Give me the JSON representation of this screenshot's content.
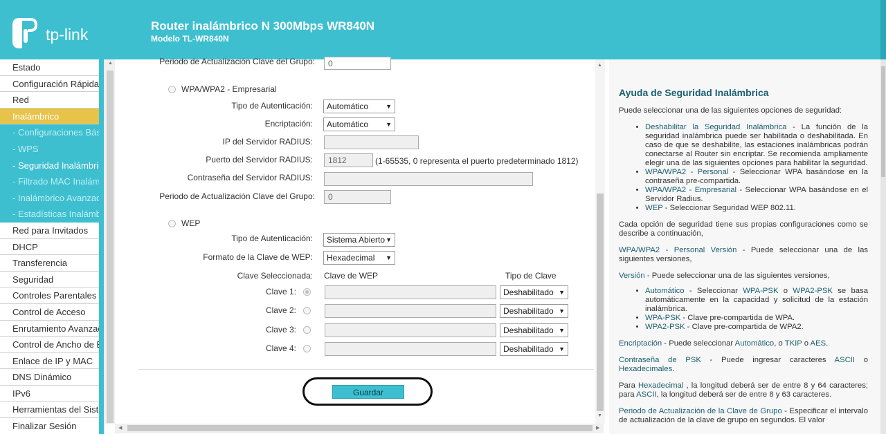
{
  "header": {
    "logo_text": "tp-link",
    "title": "Router inalámbrico N 300Mbps WR840N",
    "model": "Modelo TL-WR840N"
  },
  "menu": [
    {
      "label": "Estado",
      "type": "item"
    },
    {
      "label": "Configuración Rápida",
      "type": "item"
    },
    {
      "label": "Red",
      "type": "item"
    },
    {
      "label": "Inalámbrico",
      "type": "active"
    },
    {
      "label": "- Configuraciones Básicas",
      "type": "sub"
    },
    {
      "label": "- WPS",
      "type": "sub"
    },
    {
      "label": "- Seguridad Inalámbrica",
      "type": "current"
    },
    {
      "label": "- Filtrado MAC Inalámbrico",
      "type": "sub"
    },
    {
      "label": "- Inalámbrico Avanzado",
      "type": "sub"
    },
    {
      "label": "- Estadísticas Inalámbricas",
      "type": "sub"
    },
    {
      "label": "Red para Invitados",
      "type": "item"
    },
    {
      "label": "DHCP",
      "type": "item"
    },
    {
      "label": "Transferencia",
      "type": "item"
    },
    {
      "label": "Seguridad",
      "type": "item"
    },
    {
      "label": "Controles Parentales",
      "type": "item"
    },
    {
      "label": "Control de Acceso",
      "type": "item"
    },
    {
      "label": "Enrutamiento Avanzado",
      "type": "item"
    },
    {
      "label": "Control de Ancho de Banda",
      "type": "item"
    },
    {
      "label": "Enlace de IP y MAC",
      "type": "item"
    },
    {
      "label": "DNS Dinámico",
      "type": "item"
    },
    {
      "label": "IPv6",
      "type": "item"
    },
    {
      "label": "Herramientas del Sistema",
      "type": "item"
    },
    {
      "label": "Finalizar Sesión",
      "type": "item"
    }
  ],
  "form": {
    "top_group_label": "Periodo de Actualización Clave del Grupo:",
    "top_group_value": "0",
    "enterprise": {
      "title": "WPA/WPA2 - Empresarial",
      "auth_label": "Tipo de Autenticación:",
      "auth_value": "Automático",
      "enc_label": "Encriptación:",
      "enc_value": "Automático",
      "radius_ip_label": "IP del Servidor RADIUS:",
      "radius_ip_value": "",
      "radius_port_label": "Puerto del Servidor RADIUS:",
      "radius_port_value": "1812",
      "radius_port_hint": "(1-65535, 0 representa el puerto predeterminado 1812)",
      "radius_pass_label": "Contraseña del Servidor RADIUS:",
      "radius_pass_value": "",
      "group_label": "Periodo de Actualización Clave del Grupo:",
      "group_value": "0"
    },
    "wep": {
      "title": "WEP",
      "auth_label": "Tipo de Autenticación:",
      "auth_value": "Sistema Abierto",
      "format_label": "Formato de la Clave de WEP:",
      "format_value": "Hexadecimal",
      "selected_label": "Clave Seleccionada:",
      "key_col": "Clave de WEP",
      "type_col": "Tipo de Clave",
      "keys": [
        {
          "label": "Clave 1:",
          "type": "Deshabilitado",
          "selected": true
        },
        {
          "label": "Clave 2:",
          "type": "Deshabilitado",
          "selected": false
        },
        {
          "label": "Clave 3:",
          "type": "Deshabilitado",
          "selected": false
        },
        {
          "label": "Clave 4:",
          "type": "Deshabilitado",
          "selected": false
        }
      ]
    },
    "save_label": "Guardar"
  },
  "help": {
    "title": "Ayuda de Seguridad Inalámbrica",
    "intro": "Puede seleccionar una de las siguientes opciones de seguridad:",
    "options": [
      {
        "kw": "Deshabilitar la Seguridad Inalámbrica",
        "text": " - La función de la seguridad inalámbrica puede ser habilitada o deshabilitada. En caso de que se deshabilite, las estaciones inalámbricas podrán conectarse al Router sin encriptar. Se recomienda ampliamente elegir una de las siguientes opciones para habilitar la seguridad."
      },
      {
        "kw": "WPA/WPA2 - Personal",
        "text": " - Seleccionar WPA basándose en la contraseña pre-compartida."
      },
      {
        "kw": "WPA/WPA2 - Empresarial",
        "text": " - Seleccionar WPA basándose en el Servidor Radius."
      },
      {
        "kw": "WEP",
        "text": " - Seleccionar Seguridad WEP 802.11."
      }
    ],
    "each_option": "Cada opción de seguridad tiene sus propias configuraciones como se describe a continuación,",
    "personal_kw": "WPA/WPA2 - Personal Versión",
    "personal_text": " -   Puede seleccionar una de las siguientes versiones,",
    "version_kw": "Versión",
    "version_text": " -  Puede seleccionar una de las siguientes versiones,",
    "version_items": [
      {
        "kw": "Automático",
        "mid": " - Seleccionar ",
        "kw2": "WPA-PSK",
        "mid2": " o ",
        "kw3": "WPA2-PSK",
        "text": " se basa automáticamente en la capacidad y solicitud de la estación inalámbrica."
      },
      {
        "kw": "WPA-PSK",
        "text": " - Clave pre-compartida de WPA."
      },
      {
        "kw": "WPA2-PSK",
        "text": " - Clave pre-compartida de WPA2."
      }
    ],
    "enc_kw": "Encriptación",
    "enc_text": " - Puede seleccionar ",
    "enc_opt1": "Automático",
    "enc_sep1": ", o ",
    "enc_opt2": "TKIP",
    "enc_sep2": " o ",
    "enc_opt3": "AES",
    "enc_end": ".",
    "psk_kw": "Contraseña de PSK",
    "psk_text": " - Puede ingresar caracteres ",
    "psk_kw2": "ASCII",
    "psk_mid": " o ",
    "psk_kw3": "Hexadecimales",
    "psk_end": ".",
    "hex_pre": "Para ",
    "hex_kw": "Hexadecimal",
    "hex_text": " , la longitud deberá ser de entre 8 y 64 caracteres; para ",
    "hex_kw2": "ASCII",
    "hex_end": ", la longitud deberá ser de entre 8 y 63 caracteres.",
    "period_kw": "Periodo de Actualización de la Clave de Grupo",
    "period_text": " - Especificar el intervalo de actualización de la clave de grupo en segundos. El valor"
  }
}
